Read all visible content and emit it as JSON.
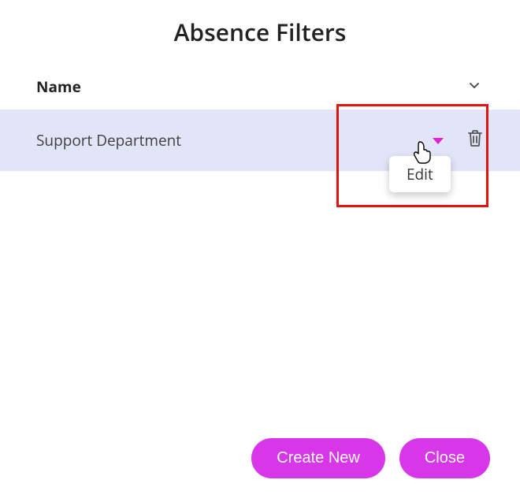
{
  "title": "Absence Filters",
  "table": {
    "header": {
      "name": "Name"
    },
    "rows": [
      {
        "name": "Support Department"
      }
    ]
  },
  "dropdown": {
    "edit": "Edit"
  },
  "footer": {
    "create": "Create New",
    "close": "Close"
  }
}
